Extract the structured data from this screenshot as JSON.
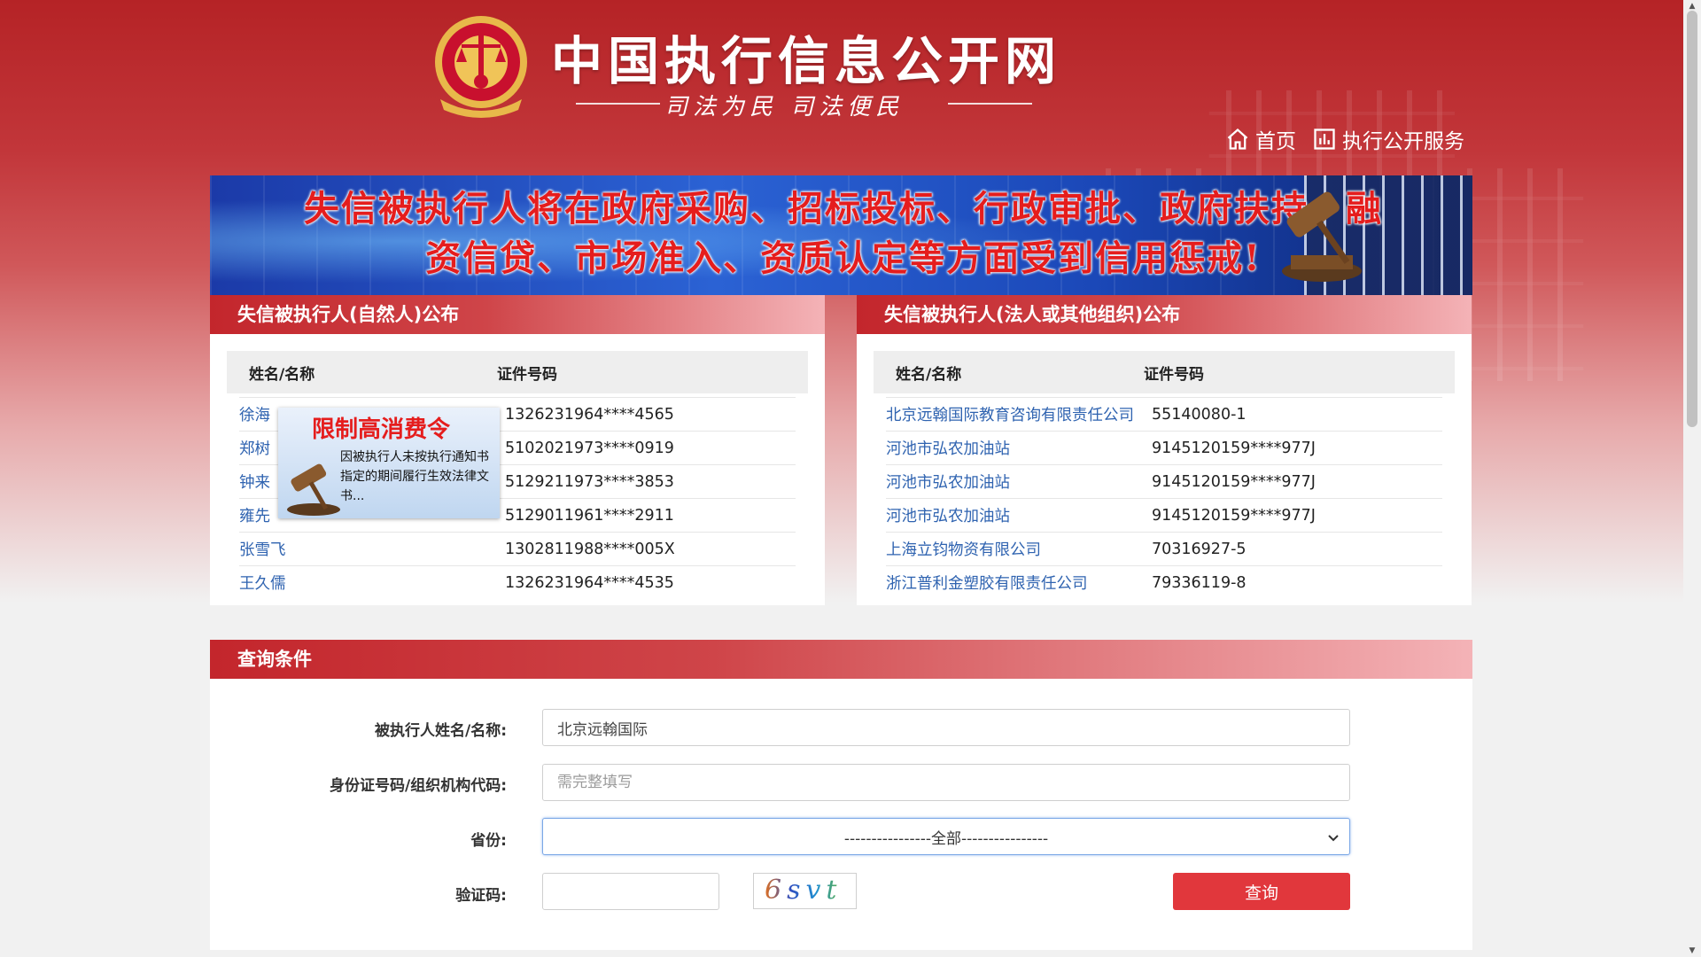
{
  "header": {
    "site_title": "中国执行信息公开网",
    "slogan": "司法为民  司法便民",
    "nav": [
      {
        "label": "首页",
        "icon": "home-icon"
      },
      {
        "label": "执行公开服务",
        "icon": "chart-icon"
      }
    ]
  },
  "banner": {
    "line1": "失信被执行人将在政府采购、招标投标、行政审批、政府扶持、融",
    "line2": "资信贷、市场准入、资质认定等方面受到信用惩戒!"
  },
  "left_panel": {
    "title": "失信被执行人(自然人)公布",
    "columns": [
      "姓名/名称",
      "证件号码"
    ],
    "rows": [
      {
        "name": "徐海",
        "code": "1326231964****4565"
      },
      {
        "name": "郑树",
        "code": "5102021973****0919"
      },
      {
        "name": "钟来",
        "code": "5129211973****3853"
      },
      {
        "name": "雍先",
        "code": "5129011961****2911"
      },
      {
        "name": "张雪飞",
        "code": "1302811988****005X"
      },
      {
        "name": "王久儒",
        "code": "1326231964****4535"
      }
    ]
  },
  "right_panel": {
    "title": "失信被执行人(法人或其他组织)公布",
    "columns": [
      "姓名/名称",
      "证件号码"
    ],
    "rows": [
      {
        "name": "北京远翰国际教育咨询有限责任公司",
        "code": "55140080-1"
      },
      {
        "name": "河池市弘农加油站",
        "code": "9145120159****977J"
      },
      {
        "name": "河池市弘农加油站",
        "code": "9145120159****977J"
      },
      {
        "name": "河池市弘农加油站",
        "code": "9145120159****977J"
      },
      {
        "name": "上海立钧物资有限公司",
        "code": "70316927-5"
      },
      {
        "name": "浙江普利金塑胶有限责任公司",
        "code": "79336119-8"
      }
    ]
  },
  "popup": {
    "title": "限制高消费令",
    "body": "因被执行人未按执行通知书指定的期间履行生效法律文书..."
  },
  "query": {
    "title": "查询条件",
    "name_label": "被执行人姓名/名称:",
    "name_value": "北京远翰国际",
    "id_label": "身份证号码/组织机构代码:",
    "id_placeholder": "需完整填写",
    "province_label": "省份:",
    "province_value": "----------------全部----------------",
    "captcha_label": "验证码:",
    "captcha_text": "6svt",
    "submit_label": "查询"
  },
  "colors": {
    "brand_red": "#c3262c",
    "link_blue": "#2f63b0",
    "button_red": "#e1373c"
  }
}
